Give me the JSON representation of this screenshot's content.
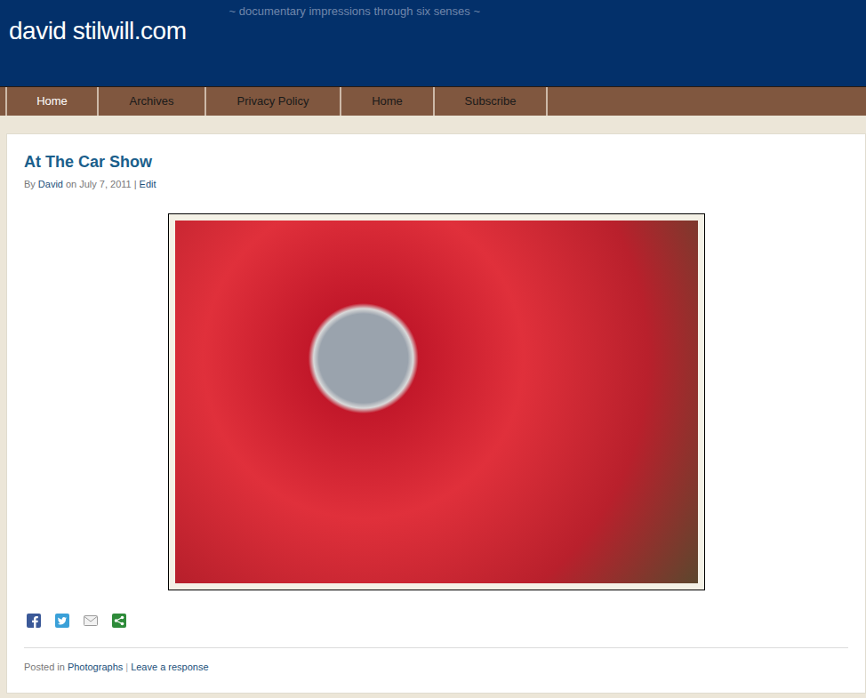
{
  "header": {
    "logo": "david stilwill.com",
    "tagline": "~ documentary impressions through six senses ~"
  },
  "nav": {
    "items": [
      {
        "label": "Home",
        "selected": true
      },
      {
        "label": "Archives",
        "selected": false
      },
      {
        "label": "Privacy Policy",
        "selected": false
      },
      {
        "label": "Home",
        "selected": false
      },
      {
        "label": "Subscribe",
        "selected": false
      }
    ]
  },
  "post": {
    "title": "At The Car Show",
    "meta": {
      "by": "By",
      "author": "David",
      "on": "on",
      "date": "July 7, 2011",
      "separator": "|",
      "edit": "Edit"
    },
    "share": [
      {
        "kind": "facebook",
        "color": "#3b5998"
      },
      {
        "kind": "twitter",
        "color": "#3aa0d8"
      },
      {
        "kind": "email",
        "color": "#9a9a9a"
      },
      {
        "kind": "share",
        "color": "#2e8b3a"
      }
    ],
    "footer": {
      "posted_in": "Posted in",
      "category": "Photographs",
      "separator": "|",
      "response": "Leave a response"
    }
  }
}
